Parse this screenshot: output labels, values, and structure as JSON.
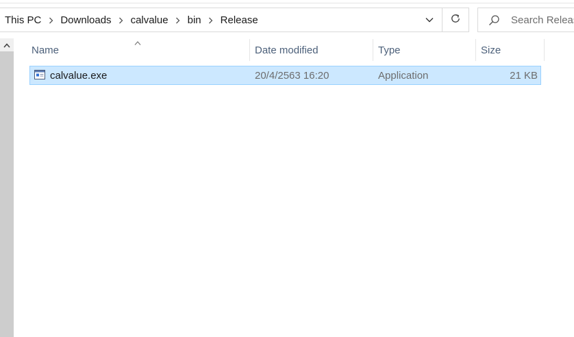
{
  "address_bar": {
    "breadcrumbs": [
      "This PC",
      "Downloads",
      "calvalue",
      "bin",
      "Release"
    ]
  },
  "search": {
    "placeholder": "Search Release"
  },
  "columns": {
    "name": "Name",
    "date_modified": "Date modified",
    "type": "Type",
    "size": "Size"
  },
  "files": [
    {
      "name": "calvalue.exe",
      "date_modified": "20/4/2563 16:20",
      "type": "Application",
      "size": "21 KB"
    }
  ],
  "colors": {
    "selection_background": "#cce8ff",
    "selection_border": "#99d1ff",
    "header_text": "#4c607a",
    "secondary_text": "#6d6d6d"
  },
  "icons": {
    "breadcrumb_separator": "chevron-right-icon",
    "address_dropdown": "chevron-down-icon",
    "refresh": "refresh-icon",
    "search": "search-icon",
    "scroll_up": "chevron-up-icon",
    "sort": "sort-ascending-icon",
    "file": "application-exe-icon"
  }
}
